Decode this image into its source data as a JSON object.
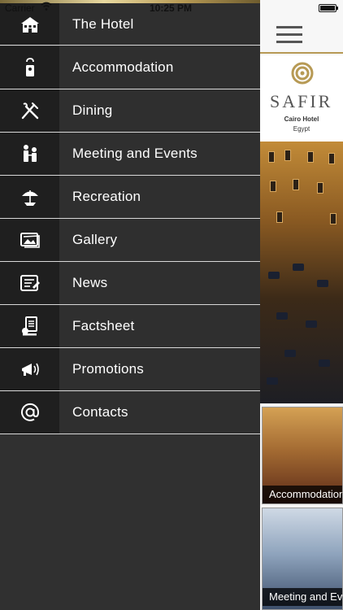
{
  "status": {
    "carrier": "Carrier",
    "time": "10:25 PM"
  },
  "menu": {
    "items": [
      {
        "label": "The Hotel",
        "icon": "hotel-building-icon"
      },
      {
        "label": "Accommodation",
        "icon": "door-hanger-icon"
      },
      {
        "label": "Dining",
        "icon": "fork-knife-icon"
      },
      {
        "label": "Meeting and Events",
        "icon": "people-meeting-icon"
      },
      {
        "label": "Recreation",
        "icon": "beach-umbrella-icon"
      },
      {
        "label": "Gallery",
        "icon": "photo-gallery-icon"
      },
      {
        "label": "News",
        "icon": "newspaper-icon"
      },
      {
        "label": "Factsheet",
        "icon": "factsheet-icon"
      },
      {
        "label": "Promotions",
        "icon": "megaphone-icon"
      },
      {
        "label": "Contacts",
        "icon": "at-sign-icon"
      }
    ]
  },
  "content": {
    "logo": {
      "brand": "SAFIR",
      "line1": "Cairo Hotel",
      "line2": "Egypt"
    },
    "thumbnails": [
      {
        "caption": "Accommodation"
      },
      {
        "caption": "Meeting and Events"
      }
    ]
  },
  "colors": {
    "menu_bg": "#2f2f2f",
    "icon_cell_bg": "#1f1f1f",
    "divider": "#d8d8d8",
    "gold_accent": "#b79a55"
  }
}
